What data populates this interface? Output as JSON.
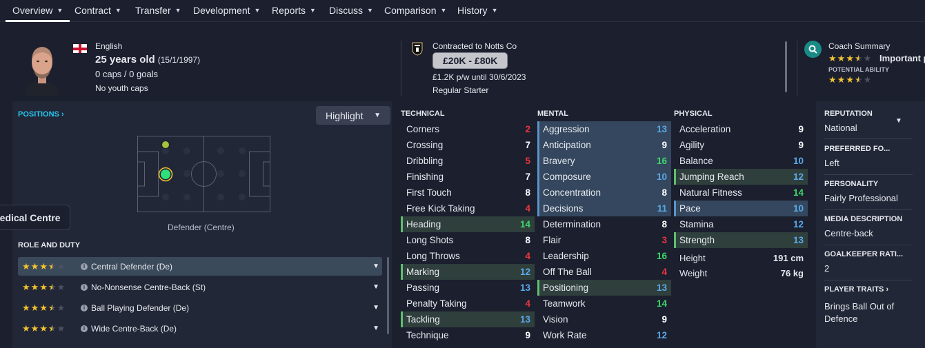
{
  "nav": [
    {
      "label": "Overview",
      "active": true
    },
    {
      "label": "Contract"
    },
    {
      "label": "Transfer"
    },
    {
      "label": "Development"
    },
    {
      "label": "Reports"
    },
    {
      "label": "Discuss"
    },
    {
      "label": "Comparison"
    },
    {
      "label": "History"
    }
  ],
  "header": {
    "nationality": "English",
    "age": "25 years old",
    "dob": "(15/1/1997)",
    "caps": "0 caps / 0 goals",
    "youth_caps": "No youth caps",
    "contract": "Contracted to Notts Co",
    "value_range": "£20K - £80K",
    "wage": "£1.2K p/w until 30/6/2023",
    "squad_status": "Regular Starter",
    "coach_summary_label": "Coach Summary",
    "coach_importance": "Important p",
    "potential_label": "POTENTIAL ABILITY",
    "current_ability_stars": 3.5,
    "potential_ability_stars": 3.5
  },
  "positions": {
    "link": "POSITIONS",
    "highlight_label": "Highlight",
    "position_label": "Defender (Centre)",
    "tooltip": "Medical Centre"
  },
  "roles": {
    "title": "ROLE AND DUTY",
    "items": [
      {
        "name": "Central Defender (De)",
        "stars": 3.5,
        "selected": true
      },
      {
        "name": "No-Nonsense Centre-Back (St)",
        "stars": 3.5
      },
      {
        "name": "Ball Playing Defender (De)",
        "stars": 3.5
      },
      {
        "name": "Wide Centre-Back (De)",
        "stars": 3.5
      }
    ]
  },
  "technical": {
    "title": "TECHNICAL",
    "items": [
      {
        "name": "Corners",
        "value": "2",
        "color": "#e8363c"
      },
      {
        "name": "Crossing",
        "value": "7",
        "color": "#ffffff"
      },
      {
        "name": "Dribbling",
        "value": "5",
        "color": "#e8363c"
      },
      {
        "name": "Finishing",
        "value": "7",
        "color": "#ffffff"
      },
      {
        "name": "First Touch",
        "value": "8",
        "color": "#ffffff"
      },
      {
        "name": "Free Kick Taking",
        "value": "4",
        "color": "#e8363c"
      },
      {
        "name": "Heading",
        "value": "14",
        "color": "#3fd66a",
        "hl": "green"
      },
      {
        "name": "Long Shots",
        "value": "8",
        "color": "#ffffff"
      },
      {
        "name": "Long Throws",
        "value": "4",
        "color": "#e8363c"
      },
      {
        "name": "Marking",
        "value": "12",
        "color": "#5aa8e8",
        "hl": "green"
      },
      {
        "name": "Passing",
        "value": "13",
        "color": "#5aa8e8"
      },
      {
        "name": "Penalty Taking",
        "value": "4",
        "color": "#e8363c"
      },
      {
        "name": "Tackling",
        "value": "13",
        "color": "#5aa8e8",
        "hl": "green"
      },
      {
        "name": "Technique",
        "value": "9",
        "color": "#ffffff"
      }
    ]
  },
  "mental": {
    "title": "MENTAL",
    "items": [
      {
        "name": "Aggression",
        "value": "13",
        "color": "#5aa8e8",
        "hl": "blue"
      },
      {
        "name": "Anticipation",
        "value": "9",
        "color": "#ffffff",
        "hl": "blue"
      },
      {
        "name": "Bravery",
        "value": "16",
        "color": "#3fd66a",
        "hl": "blue"
      },
      {
        "name": "Composure",
        "value": "10",
        "color": "#5aa8e8",
        "hl": "blue"
      },
      {
        "name": "Concentration",
        "value": "8",
        "color": "#ffffff",
        "hl": "blue"
      },
      {
        "name": "Decisions",
        "value": "11",
        "color": "#5aa8e8",
        "hl": "blue"
      },
      {
        "name": "Determination",
        "value": "8",
        "color": "#ffffff"
      },
      {
        "name": "Flair",
        "value": "3",
        "color": "#e8363c"
      },
      {
        "name": "Leadership",
        "value": "16",
        "color": "#3fd66a"
      },
      {
        "name": "Off The Ball",
        "value": "4",
        "color": "#e8363c"
      },
      {
        "name": "Positioning",
        "value": "13",
        "color": "#5aa8e8",
        "hl": "green"
      },
      {
        "name": "Teamwork",
        "value": "14",
        "color": "#3fd66a"
      },
      {
        "name": "Vision",
        "value": "9",
        "color": "#ffffff"
      },
      {
        "name": "Work Rate",
        "value": "12",
        "color": "#5aa8e8"
      }
    ]
  },
  "physical": {
    "title": "PHYSICAL",
    "items": [
      {
        "name": "Acceleration",
        "value": "9",
        "color": "#ffffff"
      },
      {
        "name": "Agility",
        "value": "9",
        "color": "#ffffff"
      },
      {
        "name": "Balance",
        "value": "10",
        "color": "#5aa8e8"
      },
      {
        "name": "Jumping Reach",
        "value": "12",
        "color": "#5aa8e8",
        "hl": "green"
      },
      {
        "name": "Natural Fitness",
        "value": "14",
        "color": "#3fd66a"
      },
      {
        "name": "Pace",
        "value": "10",
        "color": "#5aa8e8",
        "hl": "blue"
      },
      {
        "name": "Stamina",
        "value": "12",
        "color": "#5aa8e8"
      },
      {
        "name": "Strength",
        "value": "13",
        "color": "#5aa8e8",
        "hl": "green"
      }
    ],
    "height_label": "Height",
    "height": "191 cm",
    "weight_label": "Weight",
    "weight": "76 kg"
  },
  "side": {
    "reputation_label": "REPUTATION",
    "reputation": "National",
    "foot_label": "PREFERRED FO...",
    "foot": "Left",
    "personality_label": "PERSONALITY",
    "personality": "Fairly Professional",
    "media_label": "MEDIA DESCRIPTION",
    "media": "Centre-back",
    "gk_label": "GOALKEEPER RATI...",
    "gk": "2",
    "traits_label": "PLAYER TRAITS",
    "traits_line1": "Brings Ball Out of",
    "traits_line2": "Defence"
  }
}
